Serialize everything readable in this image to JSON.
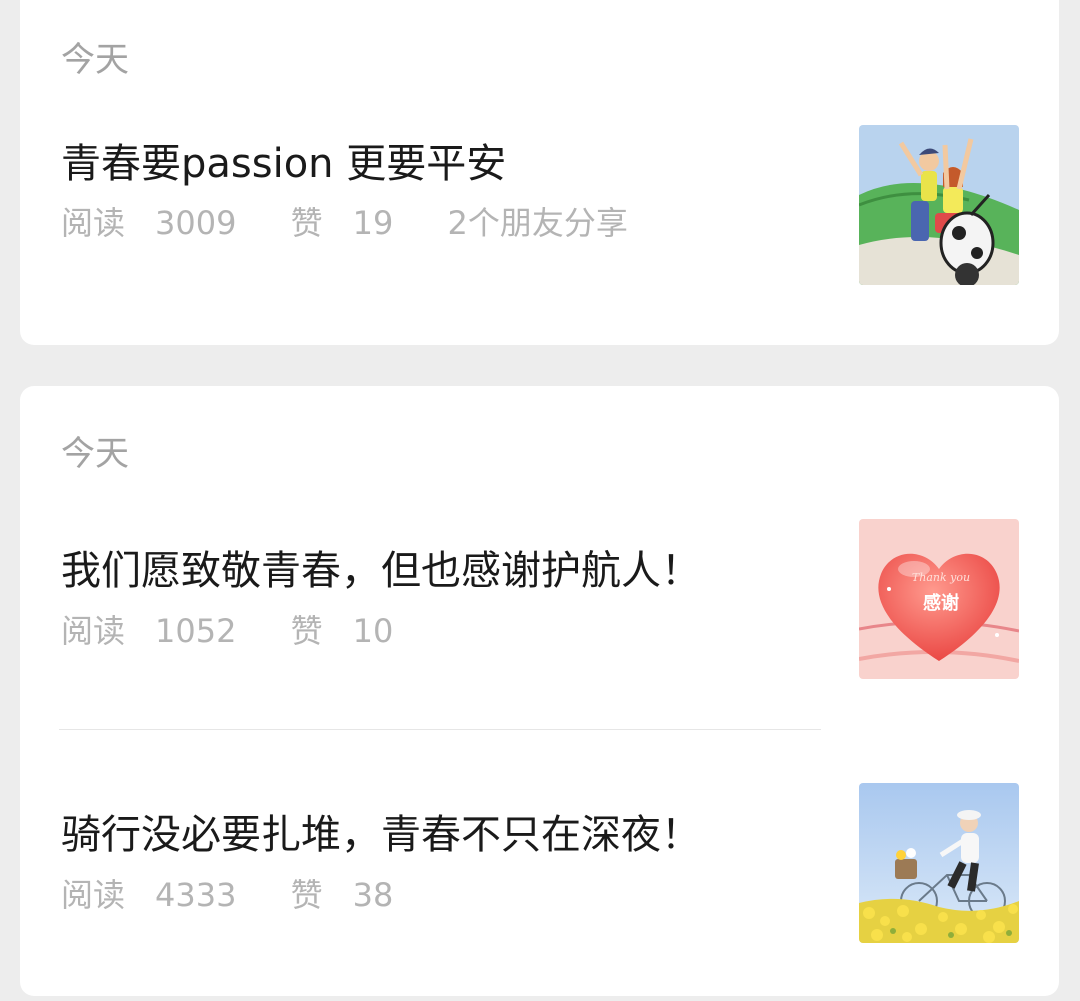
{
  "cards": [
    {
      "date": "今天",
      "articles": [
        {
          "title": "青春要passion  更要平安",
          "read_label": "阅读",
          "read_count": "3009",
          "like_label": "赞",
          "like_count": "19",
          "share_text": "2个朋友分享",
          "thumbnail": "cartoon-couple-on-scooter"
        }
      ]
    },
    {
      "date": "今天",
      "articles": [
        {
          "title": "我们愿致敬青春，但也感谢护航人！",
          "read_label": "阅读",
          "read_count": "1052",
          "like_label": "赞",
          "like_count": "10",
          "thumbnail": "red-heart-thank-you",
          "thumbnail_text": "感谢",
          "thumbnail_script": "Thank you"
        },
        {
          "title": "骑行没必要扎堆，青春不只在深夜！",
          "read_label": "阅读",
          "read_count": "4333",
          "like_label": "赞",
          "like_count": "38",
          "thumbnail": "girl-cycling-in-flower-field"
        }
      ]
    }
  ]
}
